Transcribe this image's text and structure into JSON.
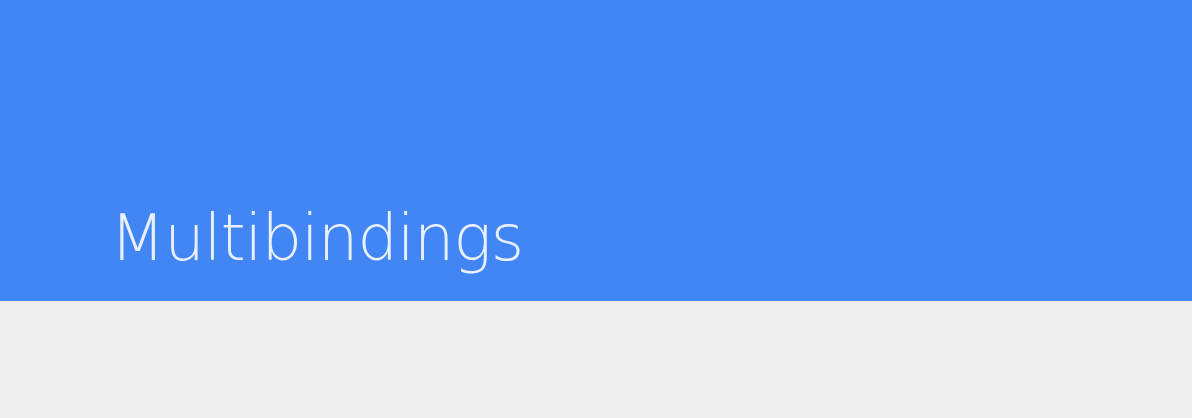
{
  "header": {
    "title": "Multibindings"
  },
  "colors": {
    "banner_background": "#4285f4",
    "title_text": "#e8f0fe",
    "page_background": "#efefef"
  }
}
